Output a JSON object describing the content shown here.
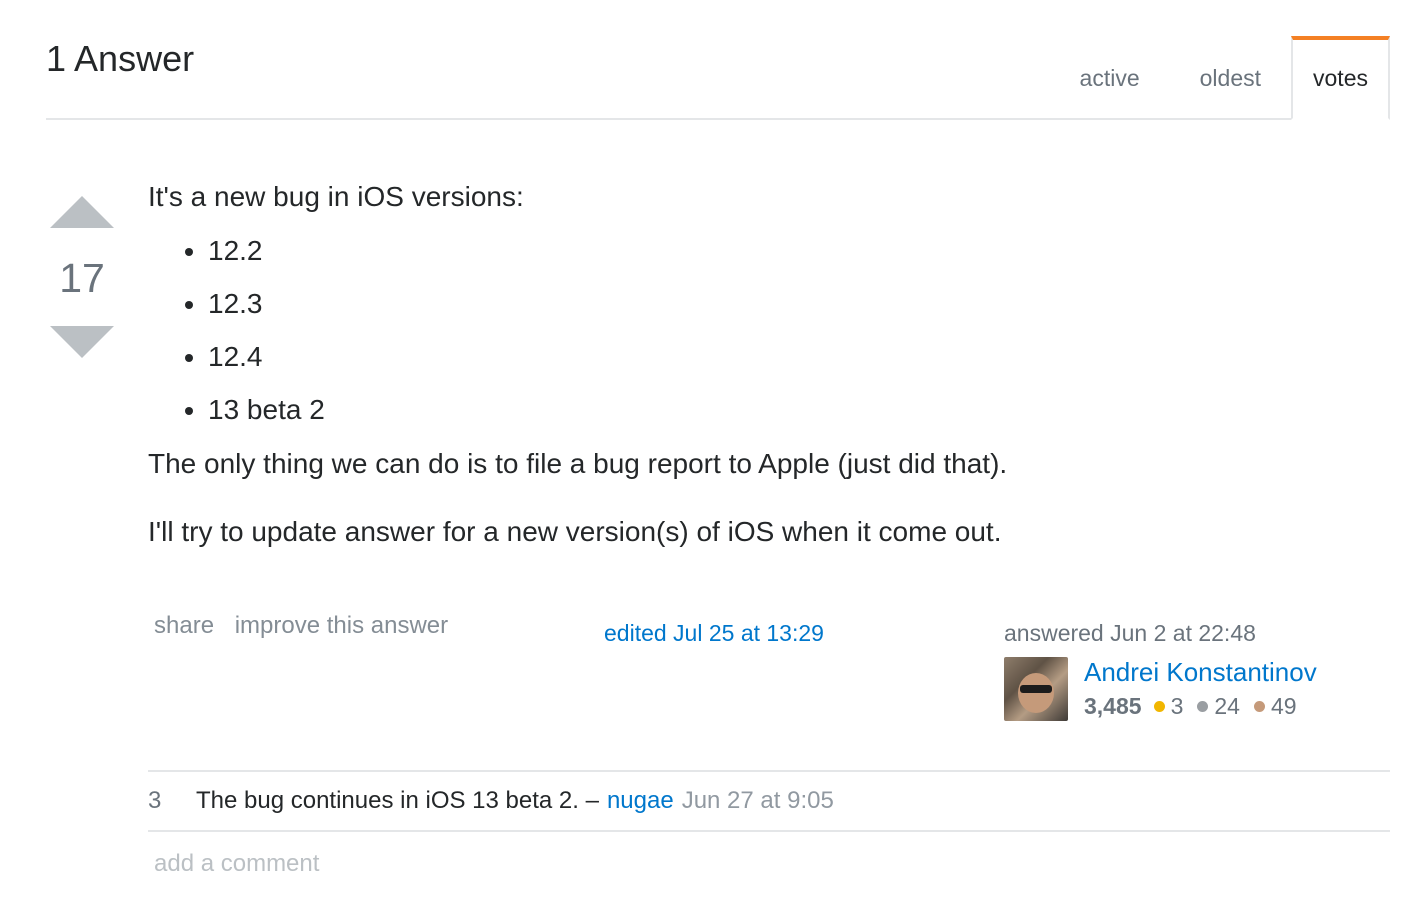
{
  "header": {
    "title": "1 Answer",
    "tabs": [
      {
        "label": "active"
      },
      {
        "label": "oldest"
      },
      {
        "label": "votes"
      }
    ]
  },
  "vote": {
    "count": "17"
  },
  "post": {
    "intro": "It's a new bug in iOS versions:",
    "versions": [
      "12.2",
      "12.3",
      "12.4",
      "13 beta 2"
    ],
    "para1": "The only thing we can do is to file a bug report to Apple (just did that).",
    "para2": "I'll try to update answer for a new version(s) of iOS when it come out."
  },
  "menu": {
    "share": "share",
    "improve": "improve this answer"
  },
  "edited": "edited Jul 25 at 13:29",
  "user": {
    "action": "answered Jun 2 at 22:48",
    "name": "Andrei Konstantinov",
    "reputation": "3,485",
    "gold": "3",
    "silver": "24",
    "bronze": "49"
  },
  "colors": {
    "gold": "#f1b600",
    "silver": "#9a9ea2",
    "bronze": "#c59a7a",
    "accent": "#f48024",
    "link": "#0077cc"
  },
  "comments": [
    {
      "score": "3",
      "text": "The bug continues in iOS 13 beta 2. –",
      "user": "nugae",
      "date": "Jun 27 at 9:05"
    }
  ],
  "add_comment": "add a comment"
}
